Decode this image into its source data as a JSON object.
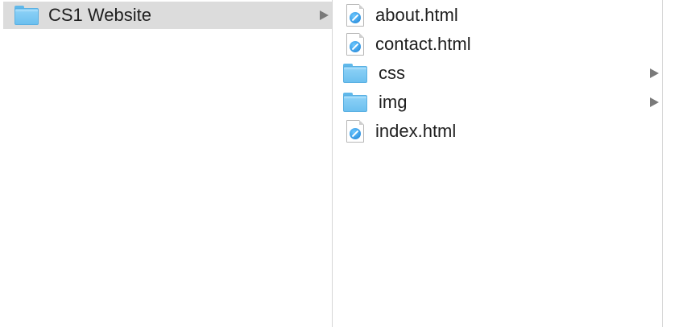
{
  "columns": [
    {
      "items": [
        {
          "label": "CS1 Website",
          "type": "folder",
          "selected": true,
          "has_children": true
        }
      ]
    },
    {
      "items": [
        {
          "label": "about.html",
          "type": "html-file",
          "has_children": false
        },
        {
          "label": "contact.html",
          "type": "html-file",
          "has_children": false
        },
        {
          "label": "css",
          "type": "folder",
          "has_children": true
        },
        {
          "label": "img",
          "type": "folder",
          "has_children": true
        },
        {
          "label": "index.html",
          "type": "html-file",
          "has_children": false
        }
      ]
    }
  ],
  "icons": {
    "folder": "folder-icon",
    "html_file": "safari-html-document-icon",
    "disclosure": "disclosure-triangle-right-icon"
  },
  "colors": {
    "selection": "#dcdcdc",
    "folder_blue": "#6cc0ef",
    "text": "#1f1f1f",
    "divider": "#d6d6d6"
  }
}
